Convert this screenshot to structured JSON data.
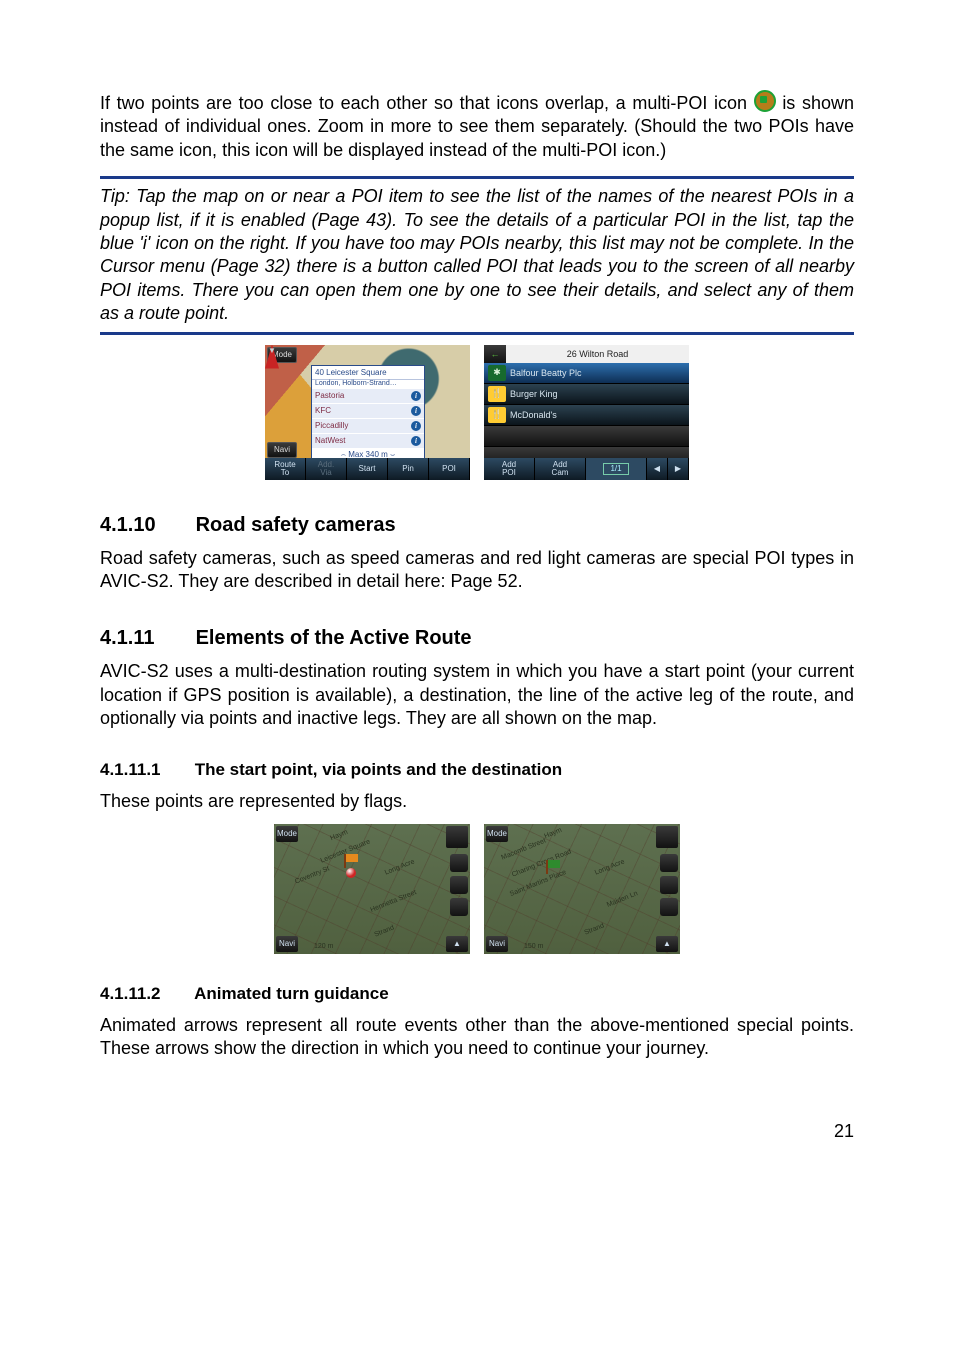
{
  "intro_prefix": "If two points are too close to each other so that icons overlap, a multi-POI icon ",
  "intro_suffix": " is shown instead of individual ones. Zoom in more to see them separately. (Should the two POIs have the same icon, this icon will be displayed instead of the multi-POI icon.)",
  "tip": "Tip: Tap the map on or near a POI item to see the list of the names of the nearest POIs in a popup list, if it is enabled (Page 43). To see the details of a particular POI in the list, tap the blue 'i' icon on the right. If you have too may POIs nearby, this list may not be complete. In the Cursor menu (Page 32) there is a button called POI that leads you to the screen of all nearby POI items. There you can open them one by one to see their details, and select any of them as a route point.",
  "fig1": {
    "a": {
      "mode": "Mode",
      "navi": "Navi",
      "popup_title": "40 Leicester Square",
      "popup_sub": "London, Holborn-Strand…",
      "rows": [
        "Pastoria",
        "KFC",
        "Piccadilly",
        "NatWest"
      ],
      "bottom": [
        "Route\nTo",
        "Add.\nVia",
        "Start",
        "Pin",
        "POI"
      ]
    },
    "b": {
      "addr": "26 Wilton Road",
      "items": [
        {
          "label": "Balfour Beatty Plc",
          "icon": "✱",
          "selected": true
        },
        {
          "label": "Burger King",
          "icon": "🍴",
          "selected": false
        },
        {
          "label": "McDonald's",
          "icon": "🍴",
          "selected": false
        }
      ],
      "bottom": {
        "addpoi": "Add\nPOI",
        "addcam": "Add\nCam",
        "count": "1/1"
      }
    }
  },
  "sec10": {
    "num": "4.1.10",
    "title": "Road safety cameras",
    "body": "Road safety cameras, such as speed cameras and red light cameras are special POI types in AVIC-S2. They are described in detail here: Page 52."
  },
  "sec11": {
    "num": "4.1.11",
    "title": "Elements of the Active Route",
    "body": "AVIC-S2 uses a multi-destination routing system in which you have a start point (your current location if GPS position is available), a destination, the line of the active leg of the route, and optionally via points and inactive legs. They are all shown on the map."
  },
  "sec11_1": {
    "num": "4.1.11.1",
    "title": "The start point, via points and the destination",
    "body": "These points are represented by flags."
  },
  "fig2": {
    "a": {
      "labels": [
        "Haym",
        "Leicester Square",
        "Coventry St",
        "Long Acre",
        "Henrietta Street",
        "Strand"
      ],
      "scale": "120 m"
    },
    "b": {
      "labels": [
        "Haym",
        "Macomb Street",
        "Charing Cross Road",
        "Saint Martins Place",
        "Long Acre",
        "Maiden Ln",
        "Strand"
      ],
      "scale": "150 m"
    },
    "buttons": {
      "mode": "Mode",
      "navi": "Navi"
    }
  },
  "sec11_2": {
    "num": "4.1.11.2",
    "title": "Animated turn guidance",
    "body": "Animated arrows represent all route events other than the above-mentioned special points. These arrows show the direction in which you need to continue your journey."
  },
  "page_number": "21"
}
